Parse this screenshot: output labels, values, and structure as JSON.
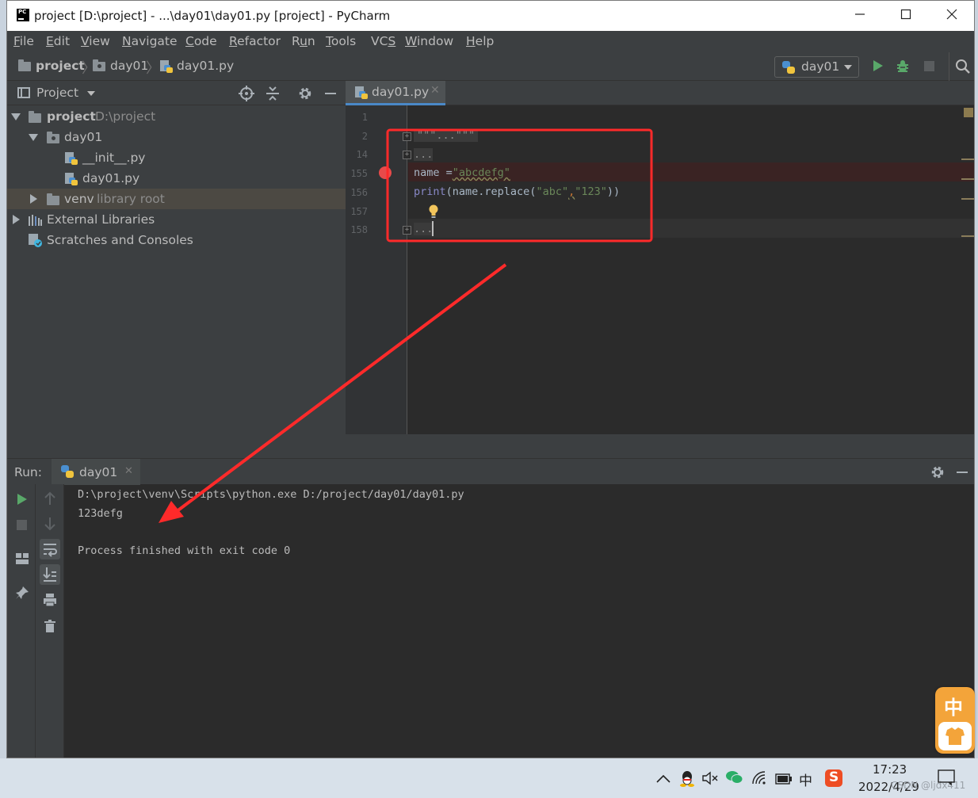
{
  "window": {
    "title": "project [D:\\project] - ...\\day01\\day01.py [project] - PyCharm",
    "logo_text": "PC",
    "minimize_icon": "minimize-icon",
    "maximize_icon": "maximize-icon",
    "close_icon": "close-icon"
  },
  "menu": [
    {
      "u": "F",
      "rest": "ile"
    },
    {
      "u": "E",
      "rest": "dit"
    },
    {
      "u": "V",
      "rest": "iew"
    },
    {
      "u": "N",
      "rest": "avigate"
    },
    {
      "u": "C",
      "rest": "ode"
    },
    {
      "u": "R",
      "rest": "efactor"
    },
    {
      "u": "",
      "rest": "R",
      "u2": "u",
      "rest2": "n"
    },
    {
      "u": "T",
      "rest": "ools"
    },
    {
      "u": "",
      "rest": "VC",
      "u2": "S",
      "rest2": ""
    },
    {
      "u": "W",
      "rest": "indow"
    },
    {
      "u": "H",
      "rest": "elp"
    }
  ],
  "breadcrumb": {
    "project": "project",
    "folder": "day01",
    "file": "day01.py"
  },
  "run_config": {
    "label": "day01"
  },
  "project_panel": {
    "title": "Project",
    "tree": {
      "root_name": "project",
      "root_path": "D:\\project",
      "day01": "day01",
      "init_file": "__init__.py",
      "day01_file": "day01.py",
      "venv": "venv",
      "venv_suffix": "library root",
      "external": "External Libraries",
      "scratches": "Scratches and Consoles"
    }
  },
  "editor": {
    "tab_label": "day01.py",
    "line_numbers": [
      "1",
      "2",
      "14",
      "155",
      "156",
      "157",
      "158"
    ],
    "line2_text": "\"\"\"...\"\"\"",
    "line14_text": "...",
    "line155": {
      "var": "name",
      "op": " =",
      "str": "\"abcdefg\""
    },
    "line156": {
      "fn": "print",
      "pre": "(name.replace(",
      "s1": "\"abc\"",
      "comma": ",",
      "s2": "\"123\"",
      "post": "))"
    },
    "line158_text": "..."
  },
  "run_panel": {
    "label": "Run:",
    "tab_label": "day01",
    "output": [
      "D:\\project\\venv\\Scripts\\python.exe D:/project/day01/day01.py",
      "123defg",
      "",
      "Process finished with exit code 0"
    ]
  },
  "taskbar": {
    "time": "17:23",
    "date": "2022/4/29",
    "ime": "中",
    "watermark": "CSDN @ljdx411"
  },
  "ime_float": {
    "char": "中"
  },
  "colors": {
    "annotation_red": "#ff2a2a",
    "run_green": "#59a869",
    "breakpoint": "#e84a4a",
    "string": "#6a8759",
    "builtin": "#8888c6"
  }
}
